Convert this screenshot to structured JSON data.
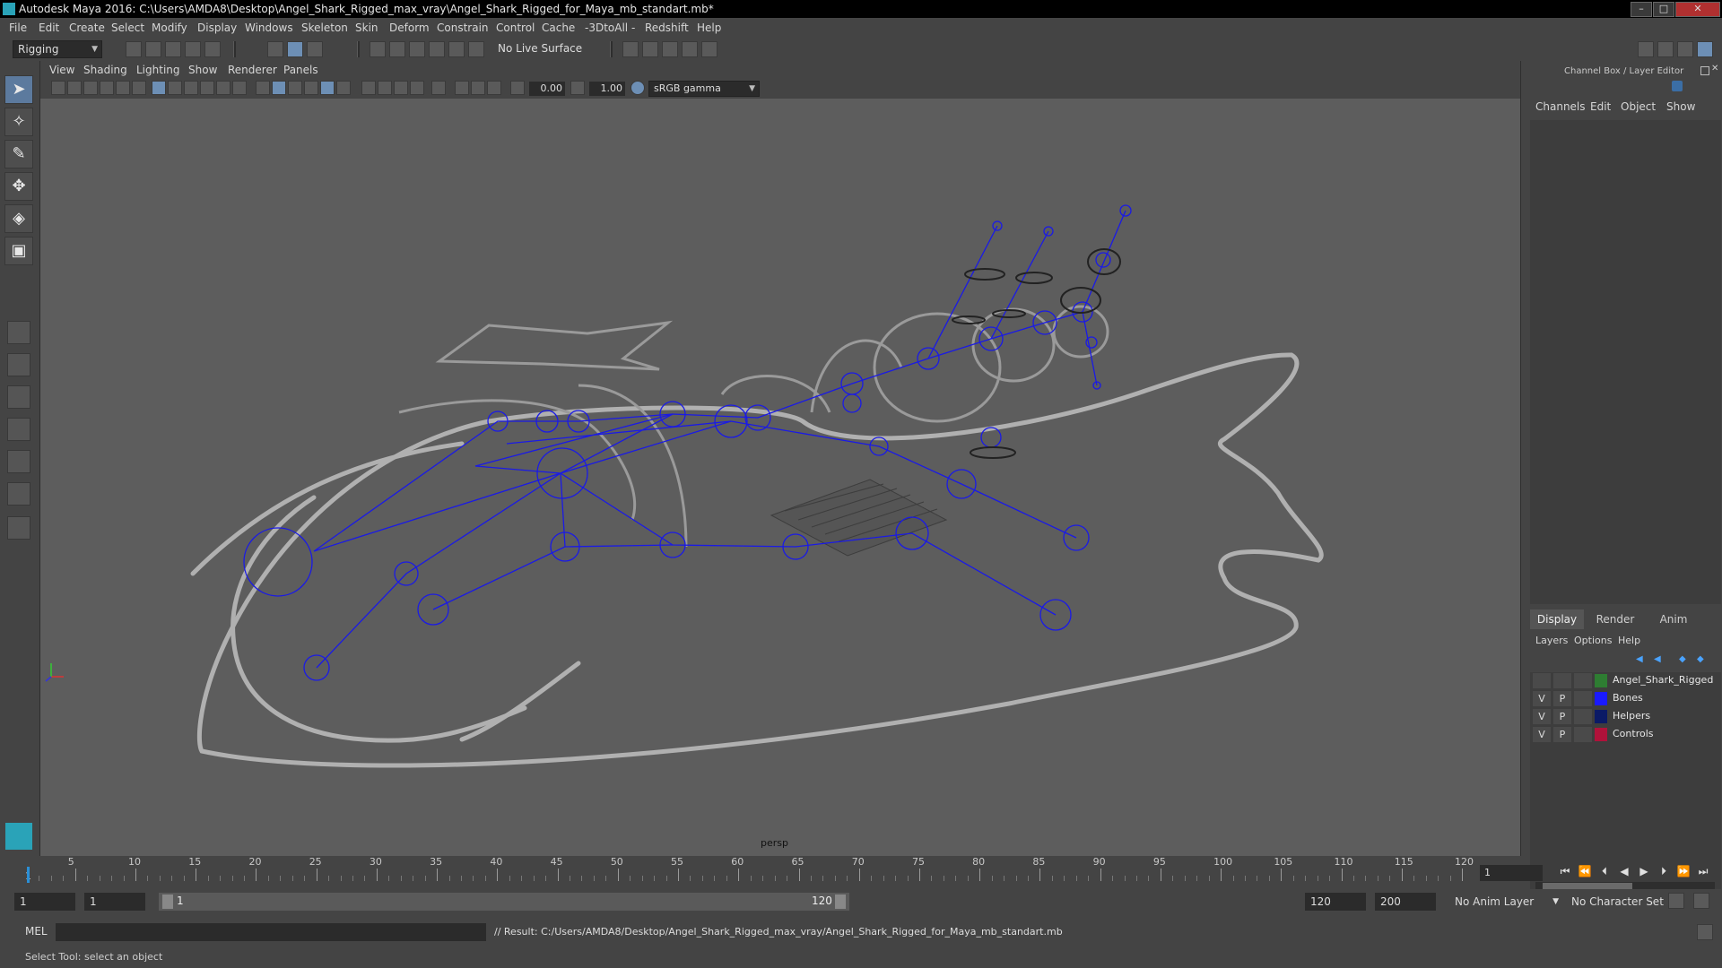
{
  "window": {
    "title": "Autodesk Maya 2016: C:\\Users\\AMDA8\\Desktop\\Angel_Shark_Rigged_max_vray\\Angel_Shark_Rigged_for_Maya_mb_standart.mb*",
    "controls": {
      "minimize": "–",
      "maximize": "□",
      "close": "✕"
    }
  },
  "menubar": [
    "File",
    "Edit",
    "Create",
    "Select",
    "Modify",
    "Display",
    "Windows",
    "Skeleton",
    "Skin",
    "Deform",
    "Constrain",
    "Control",
    "Cache",
    "-3DtoAll -",
    "Redshift",
    "Help"
  ],
  "statusline": {
    "menuset": "Rigging",
    "live_surface": "No Live Surface"
  },
  "viewport": {
    "menus": [
      "View",
      "Shading",
      "Lighting",
      "Show",
      "Renderer",
      "Panels"
    ],
    "exposure": "0.00",
    "gamma": "1.00",
    "colorspace": "sRGB gamma",
    "camera_label": "persp"
  },
  "channel_box": {
    "header": "Channel Box / Layer Editor",
    "menus": [
      "Channels",
      "Edit",
      "Object",
      "Show"
    ]
  },
  "layer_editor": {
    "tabs": [
      "Display",
      "Render",
      "Anim"
    ],
    "menus": [
      "Layers",
      "Options",
      "Help"
    ],
    "layers": [
      {
        "v": "",
        "p": "",
        "color": "#2e7d32",
        "name": "Angel_Shark_Rigged"
      },
      {
        "v": "V",
        "p": "P",
        "color": "#1a1aff",
        "name": "Bones"
      },
      {
        "v": "V",
        "p": "P",
        "color": "#0b1a66",
        "name": "Helpers"
      },
      {
        "v": "V",
        "p": "P",
        "color": "#b0123a",
        "name": "Controls"
      }
    ]
  },
  "timeline": {
    "ticks": [
      "5",
      "10",
      "15",
      "20",
      "25",
      "30",
      "35",
      "40",
      "45",
      "50",
      "55",
      "60",
      "65",
      "70",
      "75",
      "80",
      "85",
      "90",
      "95",
      "100",
      "105",
      "110",
      "115",
      "120"
    ],
    "start_tick": "1",
    "current_frame": "1"
  },
  "range": {
    "start": "1",
    "playback_start": "1",
    "slider_start": "1",
    "slider_end": "120",
    "playback_end": "120",
    "end": "200",
    "anim_layer": "No Anim Layer",
    "character_set": "No Character Set"
  },
  "command": {
    "lang": "MEL",
    "result": "// Result: C:/Users/AMDA8/Desktop/Angel_Shark_Rigged_max_vray/Angel_Shark_Rigged_for_Maya_mb_standart.mb"
  },
  "help_line": "Select Tool: select an object",
  "colors": {
    "wireframe": "#1a1ae6",
    "curve": "#b8b8b8",
    "viewport_bg": "#5d5d5d"
  }
}
